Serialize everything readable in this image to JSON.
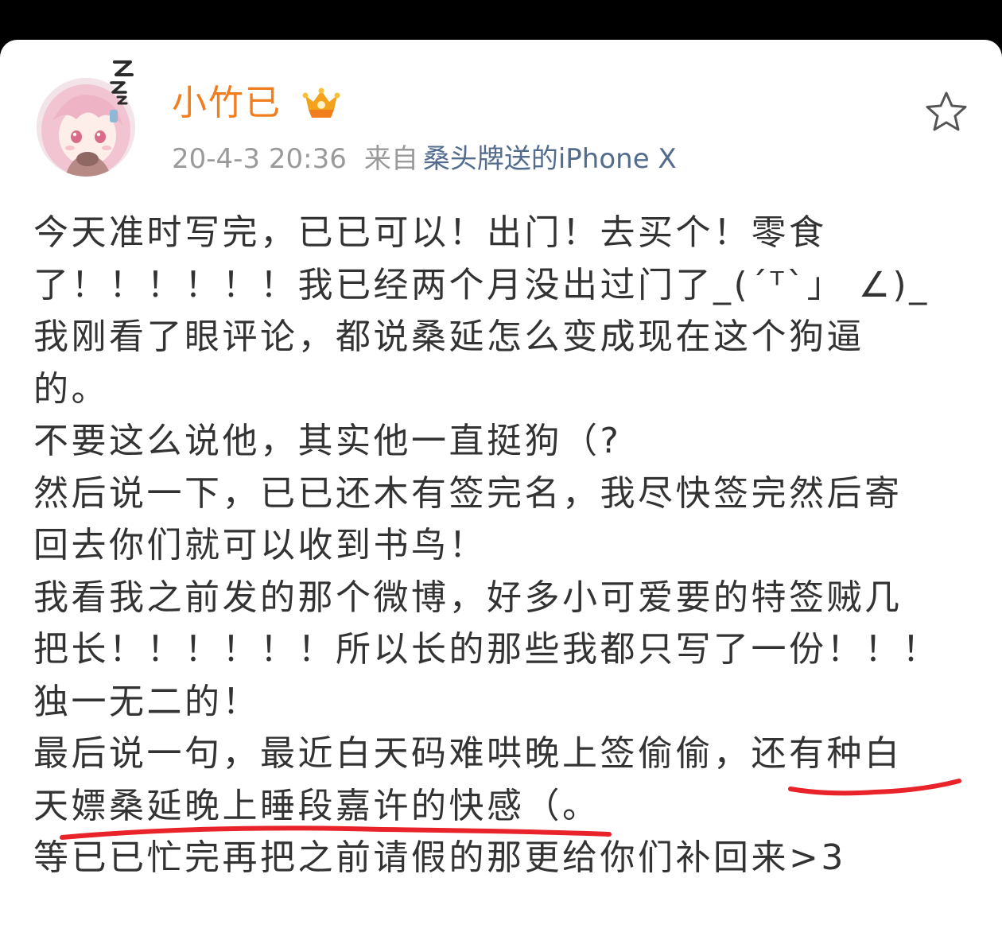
{
  "post": {
    "author": {
      "name": "小竹已",
      "badge_icon": "crown-vip-badge-icon",
      "avatar_icon": "anime-girl-avatar"
    },
    "timestamp": "20-4-3 20:36",
    "source_label": "来自",
    "source": "桑头牌送的iPhone X",
    "favorite_icon": "star-icon",
    "lines": [
      "今天准时写完，已已可以！出门！去买个！零食",
      "了！！！！！！我已经两个月没出过门了_(´ᵀ`」 ∠)_",
      "我刚看了眼评论，都说桑延怎么变成现在这个狗逼",
      "的。",
      "不要这么说他，其实他一直挺狗（?",
      "然后说一下，已已还木有签完名，我尽快签完然后寄",
      "回去你们就可以收到书鸟！",
      "我看我之前发的那个微博，好多小可爱要的特签贼几",
      "把长！！！！！！所以长的那些我都只写了一份！！！",
      "独一无二的！",
      "最后说一句，最近白天码难哄晚上签偷偷，还有种白",
      "天嫖桑延晚上睡段嘉许的快感（。",
      "等已已忙完再把之前请假的那更给你们补回来>3"
    ]
  },
  "colors": {
    "username": "#f07d1e",
    "meta_text": "#9a9a9a",
    "source_link": "#536c8e",
    "body_text": "#333333",
    "highlight_underline": "#e8232a"
  }
}
